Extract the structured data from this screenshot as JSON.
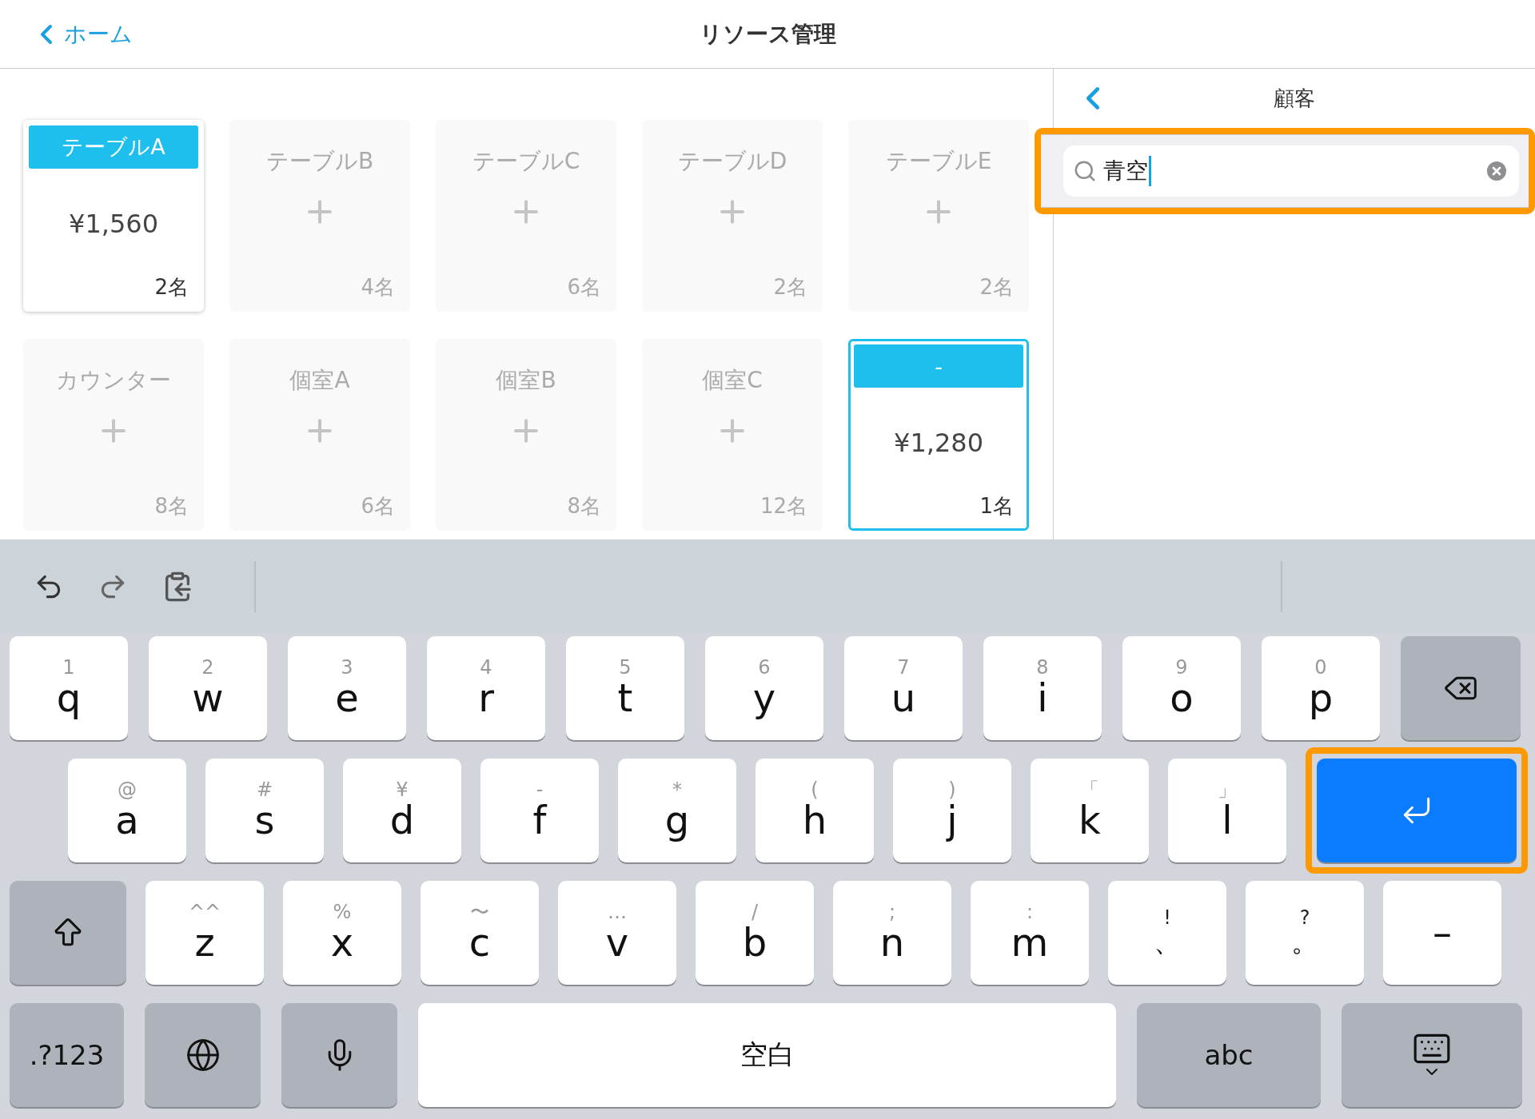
{
  "header": {
    "back": "ホーム",
    "title": "リソース管理"
  },
  "tables": [
    {
      "name": "テーブルA",
      "occupied": true,
      "selected": false,
      "price": "¥1,560",
      "seats": "2名"
    },
    {
      "name": "テーブルB",
      "occupied": false,
      "selected": false,
      "seats": "4名"
    },
    {
      "name": "テーブルC",
      "occupied": false,
      "selected": false,
      "seats": "6名"
    },
    {
      "name": "テーブルD",
      "occupied": false,
      "selected": false,
      "seats": "2名"
    },
    {
      "name": "テーブルE",
      "occupied": false,
      "selected": false,
      "seats": "2名"
    },
    {
      "name": "カウンター",
      "occupied": false,
      "selected": false,
      "seats": "8名"
    },
    {
      "name": "個室A",
      "occupied": false,
      "selected": false,
      "seats": "6名"
    },
    {
      "name": "個室B",
      "occupied": false,
      "selected": false,
      "seats": "8名"
    },
    {
      "name": "個室C",
      "occupied": false,
      "selected": false,
      "seats": "12名"
    },
    {
      "name": "-",
      "occupied": true,
      "selected": true,
      "price": "¥1,280",
      "seats": "1名"
    }
  ],
  "customer_panel": {
    "title": "顧客",
    "search": {
      "value": "青空",
      "highlighted": true
    }
  },
  "keyboard": {
    "letter_row_1": [
      {
        "kind": "letter",
        "label": "q",
        "hint": "1"
      },
      {
        "kind": "letter",
        "label": "w",
        "hint": "2"
      },
      {
        "kind": "letter",
        "label": "e",
        "hint": "3"
      },
      {
        "kind": "letter",
        "label": "r",
        "hint": "4"
      },
      {
        "kind": "letter",
        "label": "t",
        "hint": "5"
      },
      {
        "kind": "letter",
        "label": "y",
        "hint": "6"
      },
      {
        "kind": "letter",
        "label": "u",
        "hint": "7"
      },
      {
        "kind": "letter",
        "label": "i",
        "hint": "8"
      },
      {
        "kind": "letter",
        "label": "o",
        "hint": "9"
      },
      {
        "kind": "letter",
        "label": "p",
        "hint": "0"
      },
      {
        "kind": "backspace"
      }
    ],
    "letter_row_2": [
      {
        "kind": "letter",
        "label": "a",
        "hint": "@"
      },
      {
        "kind": "letter",
        "label": "s",
        "hint": "#"
      },
      {
        "kind": "letter",
        "label": "d",
        "hint": "¥"
      },
      {
        "kind": "letter",
        "label": "f",
        "hint": "-"
      },
      {
        "kind": "letter",
        "label": "g",
        "hint": "*"
      },
      {
        "kind": "letter",
        "label": "h",
        "hint": "("
      },
      {
        "kind": "letter",
        "label": "j",
        "hint": ")"
      },
      {
        "kind": "letter",
        "label": "k",
        "hint": "「"
      },
      {
        "kind": "letter",
        "label": "l",
        "hint": "」"
      },
      {
        "kind": "return",
        "highlighted": true
      }
    ],
    "letter_row_3": [
      {
        "kind": "shift"
      },
      {
        "kind": "letter",
        "label": "z",
        "hint": "^^"
      },
      {
        "kind": "letter",
        "label": "x",
        "hint": "%"
      },
      {
        "kind": "letter",
        "label": "c",
        "hint": "〜"
      },
      {
        "kind": "letter",
        "label": "v",
        "hint": "…"
      },
      {
        "kind": "letter",
        "label": "b",
        "hint": "/"
      },
      {
        "kind": "letter",
        "label": "n",
        "hint": ";"
      },
      {
        "kind": "letter",
        "label": "m",
        "hint": ":"
      },
      {
        "kind": "punct",
        "label": "、",
        "hint": "!"
      },
      {
        "kind": "punct",
        "label": "。",
        "hint": "?"
      },
      {
        "kind": "letter",
        "label": "–"
      }
    ],
    "function_row": [
      {
        "kind": "numbers",
        "label": ".?123"
      },
      {
        "kind": "globe"
      },
      {
        "kind": "mic"
      },
      {
        "kind": "space",
        "label": "空白"
      },
      {
        "kind": "abc",
        "label": "abc"
      },
      {
        "kind": "dismiss"
      }
    ]
  }
}
